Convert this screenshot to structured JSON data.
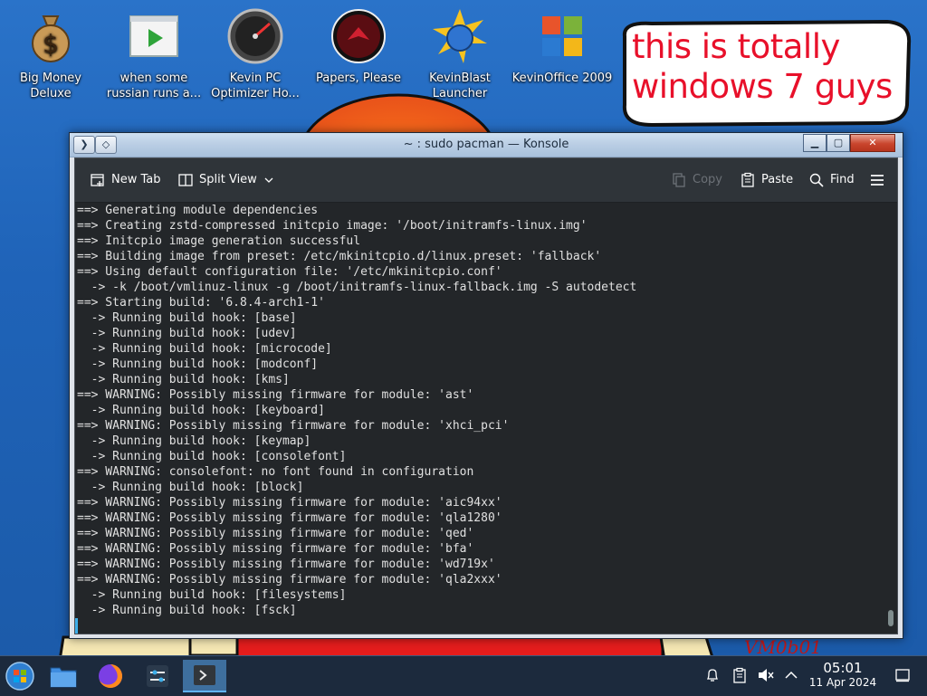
{
  "desktop": {
    "icons": [
      {
        "label": "Big Money Deluxe",
        "icon": "money-bag-icon"
      },
      {
        "label": "when some russian runs a...",
        "icon": "video-file-icon"
      },
      {
        "label": "Kevin PC Optimizer Ho...",
        "icon": "speedometer-icon"
      },
      {
        "label": "Papers, Please",
        "icon": "papers-please-icon"
      },
      {
        "label": "KevinBlast Launcher",
        "icon": "globe-launcher-icon"
      },
      {
        "label": "KevinOffice 2009",
        "icon": "office-logo-icon"
      }
    ],
    "bubble_text_line1": "this is totally",
    "bubble_text_line2": "windows 7 guys",
    "wallpaper_text": "VM0b01",
    "colors": {
      "desktop_blue": "#2a73c9",
      "bubble_text": "#e8102a"
    }
  },
  "window": {
    "title": "~ : sudo pacman — Konsole",
    "toolbar": {
      "new_tab": "New Tab",
      "split_view": "Split View",
      "copy": "Copy",
      "paste": "Paste",
      "find": "Find"
    },
    "terminal_lines": [
      "==> Generating module dependencies",
      "==> Creating zstd-compressed initcpio image: '/boot/initramfs-linux.img'",
      "==> Initcpio image generation successful",
      "==> Building image from preset: /etc/mkinitcpio.d/linux.preset: 'fallback'",
      "==> Using default configuration file: '/etc/mkinitcpio.conf'",
      "  -> -k /boot/vmlinuz-linux -g /boot/initramfs-linux-fallback.img -S autodetect",
      "==> Starting build: '6.8.4-arch1-1'",
      "  -> Running build hook: [base]",
      "  -> Running build hook: [udev]",
      "  -> Running build hook: [microcode]",
      "  -> Running build hook: [modconf]",
      "  -> Running build hook: [kms]",
      "==> WARNING: Possibly missing firmware for module: 'ast'",
      "  -> Running build hook: [keyboard]",
      "==> WARNING: Possibly missing firmware for module: 'xhci_pci'",
      "  -> Running build hook: [keymap]",
      "  -> Running build hook: [consolefont]",
      "==> WARNING: consolefont: no font found in configuration",
      "  -> Running build hook: [block]",
      "==> WARNING: Possibly missing firmware for module: 'aic94xx'",
      "==> WARNING: Possibly missing firmware for module: 'qla1280'",
      "==> WARNING: Possibly missing firmware for module: 'qed'",
      "==> WARNING: Possibly missing firmware for module: 'bfa'",
      "==> WARNING: Possibly missing firmware for module: 'wd719x'",
      "==> WARNING: Possibly missing firmware for module: 'qla2xxx'",
      "  -> Running build hook: [filesystems]",
      "  -> Running build hook: [fsck]"
    ]
  },
  "taskbar": {
    "time": "05:01",
    "date": "11 Apr 2024"
  }
}
